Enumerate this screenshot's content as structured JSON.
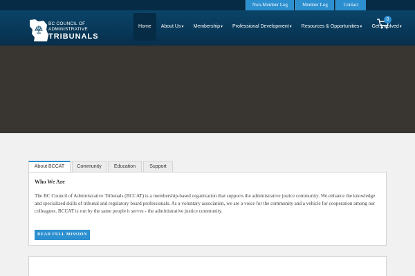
{
  "topbar": {
    "links": [
      "Non-Member Log In",
      "Member Log In",
      "Contact Us"
    ]
  },
  "logo": {
    "line1": "BC COUNCIL OF",
    "line2": "ADMINISTRATIVE",
    "line3": "TRIBUNALS"
  },
  "nav": {
    "items": [
      {
        "label": "Home",
        "caret": ""
      },
      {
        "label": "About Us",
        "caret": "▾"
      },
      {
        "label": "Membership",
        "caret": "▾"
      },
      {
        "label": "Professional Development",
        "caret": "▾"
      },
      {
        "label": "Resources & Opportunities",
        "caret": "▾"
      },
      {
        "label": "Get Involved",
        "caret": "▾"
      }
    ]
  },
  "cart": {
    "count": "0"
  },
  "tabs": [
    "About BCCAT",
    "Community",
    "Education",
    "Support"
  ],
  "panel": {
    "title": "Who We Are",
    "body": "The BC Council of Administrative Tribunals (BCCAT) is a membership-based organization that supports the administrative justice community. We enhance the knowledge and specialized skills of tribunal and regulatory board professionals. As a voluntary association, we are a voice for the community and a vehicle for cooperation among our colleagues. BCCAT is run by the same people it serves - the administrative justice community.",
    "button": "READ FULL MISSION"
  },
  "colors": {
    "accent": "#2c8fcf",
    "header": "#0a4468",
    "hero": "#393632"
  }
}
